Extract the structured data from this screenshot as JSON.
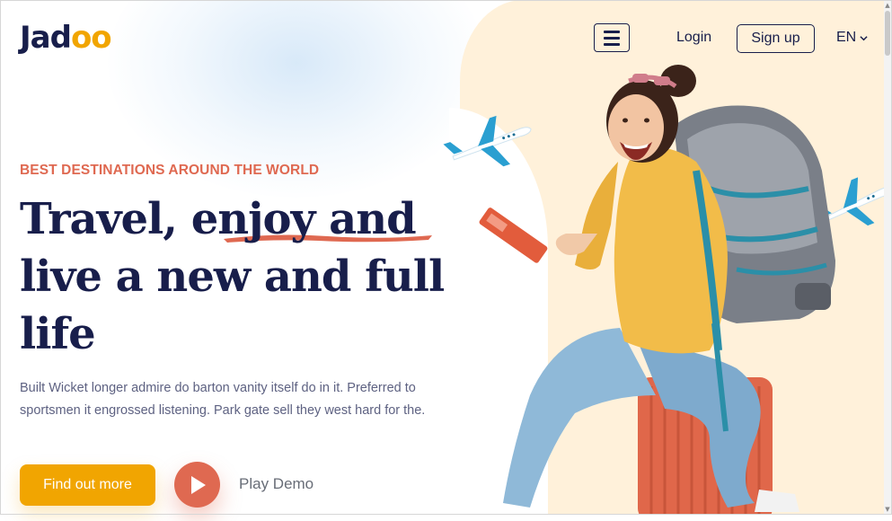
{
  "nav": {
    "logo": "Jad",
    "logo_accent": "oo",
    "login": "Login",
    "signup": "Sign up",
    "language": "EN"
  },
  "hero": {
    "tagline": "BEST DESTINATIONS AROUND THE WORLD",
    "headline": "Travel, enjoy and live a new and full life",
    "description": "Built Wicket longer admire do barton vanity itself do in it. Preferred to sportsmen it engrossed listening. Park gate sell they west hard for the.",
    "cta_label": "Find out more",
    "play_label": "Play Demo"
  },
  "colors": {
    "primary_navy": "#181e4b",
    "accent_orange": "#f1a501",
    "accent_coral": "#df6951",
    "body_text": "#5e6282",
    "panel_cream": "#fff1da"
  },
  "icons": {
    "menu": "hamburger-icon",
    "language_dropdown": "chevron-down-icon",
    "play": "play-icon",
    "planes": "airplane-icon"
  }
}
